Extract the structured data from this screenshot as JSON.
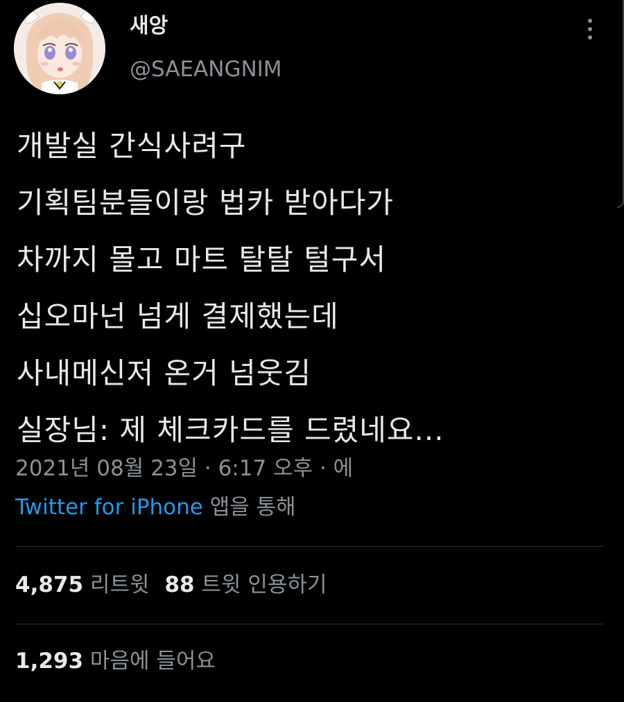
{
  "user": {
    "display_name": "새앙",
    "handle": "@SAEANGNIM"
  },
  "tweet": {
    "lines": [
      "개발실 간식사려구",
      "기획팀분들이랑 법카 받아다가",
      "차까지 몰고 마트 탈탈 털구서",
      "십오마넌 넘게 결제했는데",
      "사내메신저 온거 넘웃김",
      "실장님: 제 체크카드를 드렸네요..."
    ],
    "timestamp": "2021년 08월 23일 · 6:17 오후 · 에",
    "source_app": "Twitter for iPhone",
    "source_suffix": " 앱을 통해"
  },
  "stats": {
    "retweets": "4,875",
    "retweets_label": "리트윗",
    "quotes": "88",
    "quotes_label": "트윗 인용하기",
    "likes": "1,293",
    "likes_label": "마음에 들어요"
  },
  "colors": {
    "background": "#000000",
    "text": "#e7e9ea",
    "secondary": "#8b9197",
    "link": "#1d9bf0",
    "divider": "#2f3336"
  },
  "icons": {
    "more": "more-vertical-icon",
    "avatar": "anime-avatar-image"
  }
}
